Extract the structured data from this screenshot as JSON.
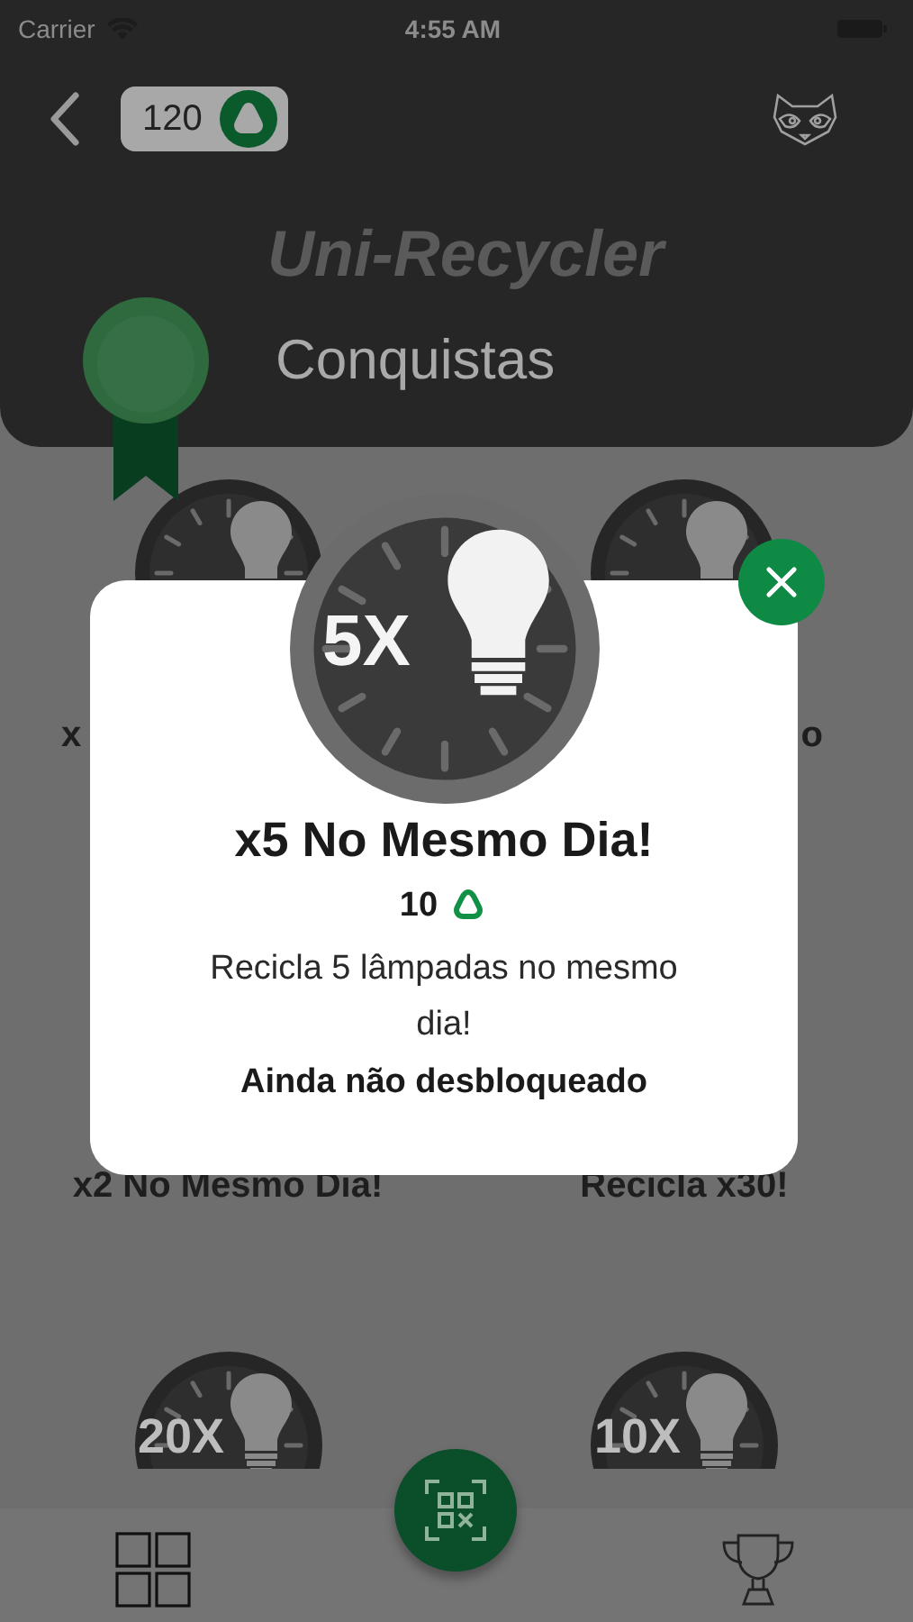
{
  "status_bar": {
    "carrier": "Carrier",
    "time": "4:55 AM"
  },
  "header": {
    "points": "120",
    "app_title": "Uni-Recycler",
    "title": "Conquistas"
  },
  "achievements": [
    {
      "label": "x"
    },
    {
      "label": "o"
    },
    {
      "label": "x2 No Mesmo Dia!"
    },
    {
      "label": "Recicla x30!"
    },
    {
      "badge_text": "20X"
    },
    {
      "badge_text": "10X"
    }
  ],
  "modal": {
    "badge_text": "5X",
    "title": "x5 No Mesmo Dia!",
    "reward": "10",
    "description": "Recicla 5 lâmpadas no mesmo dia!",
    "status": "Ainda não desbloqueado"
  }
}
